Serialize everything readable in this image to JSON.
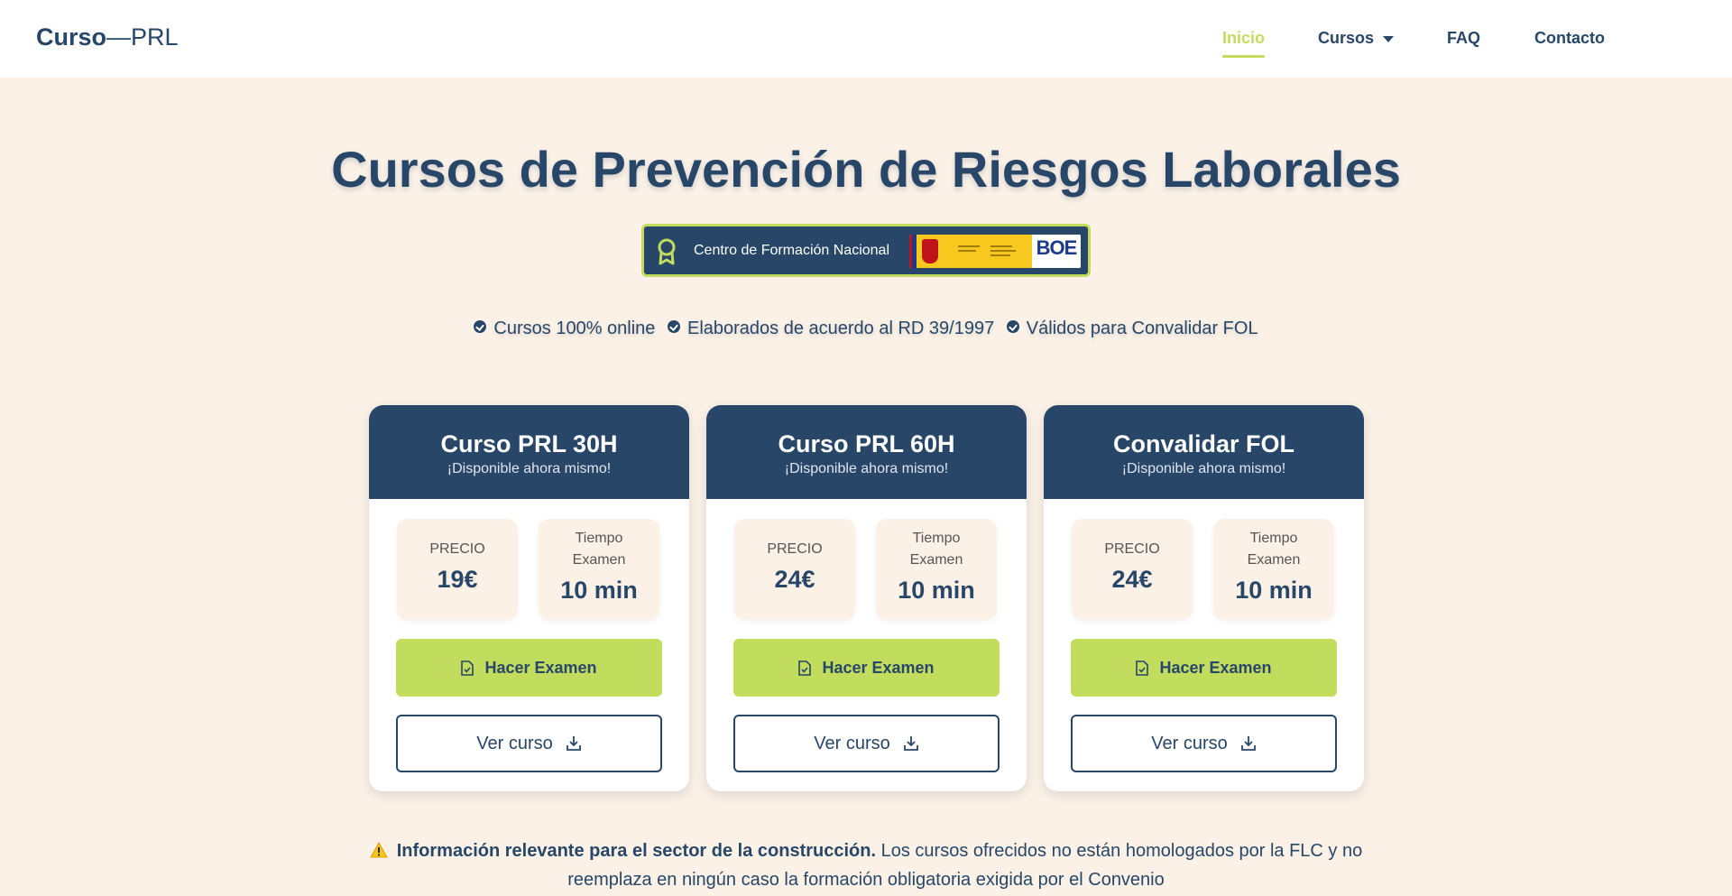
{
  "header": {
    "logo_bold": "Curso",
    "logo_rest": "—PRL",
    "nav": [
      {
        "label": "Inicio",
        "active": true
      },
      {
        "label": "Cursos",
        "dropdown": true
      },
      {
        "label": "FAQ"
      },
      {
        "label": "Contacto"
      }
    ]
  },
  "hero": {
    "title": "Cursos de Prevención de Riesgos Laborales",
    "badge_text": "Centro de Formación Nacional",
    "badge_seal_text": "BOE",
    "features": [
      "Cursos 100% online",
      "Elaborados de acuerdo al RD 39/1997",
      "Válidos para Convalidar FOL"
    ]
  },
  "cards": [
    {
      "title": "Curso PRL 30H",
      "subtitle": "¡Disponible ahora mismo!",
      "price_label": "PRECIO",
      "price": "19€",
      "time_label": "Tiempo Examen",
      "time": "10 min",
      "exam_button": "Hacer Examen",
      "view_button": "Ver curso"
    },
    {
      "title": "Curso PRL 60H",
      "subtitle": "¡Disponible ahora mismo!",
      "price_label": "PRECIO",
      "price": "24€",
      "time_label": "Tiempo Examen",
      "time": "10 min",
      "exam_button": "Hacer Examen",
      "view_button": "Ver curso"
    },
    {
      "title": "Convalidar FOL",
      "subtitle": "¡Disponible ahora mismo!",
      "price_label": "PRECIO",
      "price": "24€",
      "time_label": "Tiempo Examen",
      "time": "10 min",
      "exam_button": "Hacer Examen",
      "view_button": "Ver curso"
    }
  ],
  "notice": {
    "bold": "Información relevante para el sector de la construcción.",
    "text": " Los cursos ofrecidos no están homologados por la FLC y no reemplaza en ningún caso la formación obligatoria exigida por el Convenio"
  },
  "colors": {
    "primary": "#274668",
    "accent": "#c2dc5e",
    "background": "#fbf1e6"
  },
  "icons": [
    "award-icon",
    "check-circle-icon",
    "file-check-icon",
    "download-icon",
    "warning-icon",
    "caret-down-icon"
  ]
}
